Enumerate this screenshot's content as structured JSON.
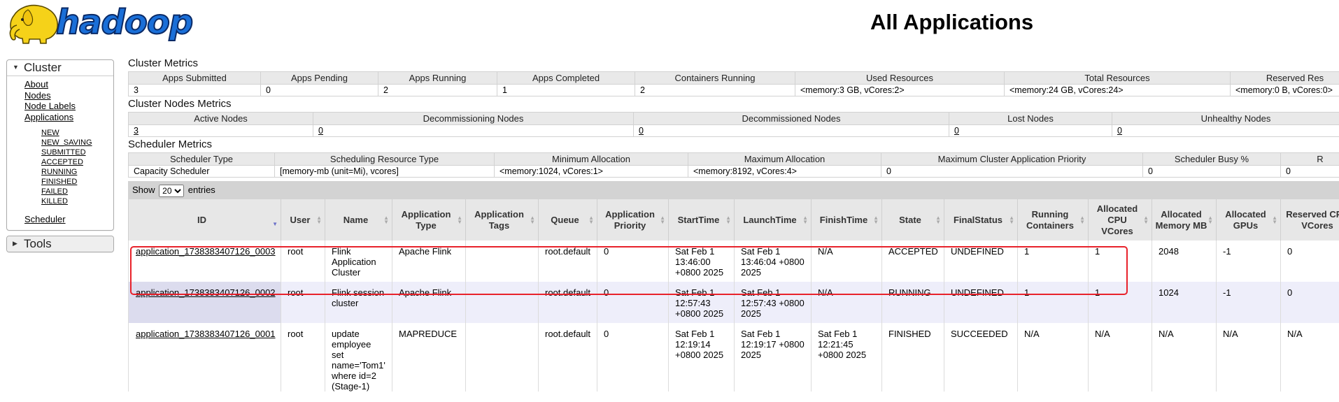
{
  "header": {
    "logo_text": "hadoop",
    "title": "All Applications"
  },
  "nav": {
    "cluster": {
      "label": "Cluster",
      "links": [
        "About",
        "Nodes",
        "Node Labels",
        "Applications"
      ],
      "states": [
        "NEW",
        "NEW_SAVING",
        "SUBMITTED",
        "ACCEPTED",
        "RUNNING",
        "FINISHED",
        "FAILED",
        "KILLED"
      ],
      "scheduler": "Scheduler"
    },
    "tools": {
      "label": "Tools"
    }
  },
  "cluster_metrics": {
    "title": "Cluster Metrics",
    "headers": [
      "Apps Submitted",
      "Apps Pending",
      "Apps Running",
      "Apps Completed",
      "Containers Running",
      "Used Resources",
      "Total Resources",
      "Reserved Res"
    ],
    "values": [
      "3",
      "0",
      "2",
      "1",
      "2",
      "<memory:3 GB, vCores:2>",
      "<memory:24 GB, vCores:24>",
      "<memory:0 B, vCores:0>"
    ]
  },
  "node_metrics": {
    "title": "Cluster Nodes Metrics",
    "headers": [
      "Active Nodes",
      "Decommissioning Nodes",
      "Decommissioned Nodes",
      "Lost Nodes",
      "Unhealthy Nodes"
    ],
    "values": [
      "3",
      "0",
      "0",
      "0",
      "0"
    ]
  },
  "scheduler_metrics": {
    "title": "Scheduler Metrics",
    "headers": [
      "Scheduler Type",
      "Scheduling Resource Type",
      "Minimum Allocation",
      "Maximum Allocation",
      "Maximum Cluster Application Priority",
      "Scheduler Busy %",
      "R"
    ],
    "values": [
      "Capacity Scheduler",
      "[memory-mb (unit=Mi), vcores]",
      "<memory:1024, vCores:1>",
      "<memory:8192, vCores:4>",
      "0",
      "0",
      "0"
    ]
  },
  "entries": {
    "show_label": "Show",
    "selected": "20",
    "options": [
      "20"
    ],
    "entries_label": "entries"
  },
  "apps_table": {
    "columns": [
      "ID",
      "User",
      "Name",
      "Application Type",
      "Application Tags",
      "Queue",
      "Application Priority",
      "StartTime",
      "LaunchTime",
      "FinishTime",
      "State",
      "FinalStatus",
      "Running Containers",
      "Allocated CPU VCores",
      "Allocated Memory MB",
      "Allocated GPUs",
      "Reserved CPU VCores"
    ],
    "rows": [
      [
        "application_1738383407126_0003",
        "root",
        "Flink Application Cluster",
        "Apache Flink",
        "",
        "root.default",
        "0",
        "Sat Feb 1 13:46:00 +0800 2025",
        "Sat Feb 1 13:46:04 +0800 2025",
        "N/A",
        "ACCEPTED",
        "UNDEFINED",
        "1",
        "1",
        "2048",
        "-1",
        "0"
      ],
      [
        "application_1738383407126_0002",
        "root",
        "Flink session cluster",
        "Apache Flink",
        "",
        "root.default",
        "0",
        "Sat Feb 1 12:57:43 +0800 2025",
        "Sat Feb 1 12:57:43 +0800 2025",
        "N/A",
        "RUNNING",
        "UNDEFINED",
        "1",
        "1",
        "1024",
        "-1",
        "0"
      ],
      [
        "application_1738383407126_0001",
        "root",
        "update employee set name='Tom1' where id=2 (Stage-1)",
        "MAPREDUCE",
        "",
        "root.default",
        "0",
        "Sat Feb 1 12:19:14 +0800 2025",
        "Sat Feb 1 12:19:17 +0800 2025",
        "Sat Feb 1 12:21:45 +0800 2025",
        "FINISHED",
        "SUCCEEDED",
        "N/A",
        "N/A",
        "N/A",
        "N/A",
        "N/A"
      ]
    ]
  },
  "colors": {
    "highlight": "#e8222b",
    "logo_blue": "#1a6fd8",
    "logo_yellow": "#f5d219"
  }
}
